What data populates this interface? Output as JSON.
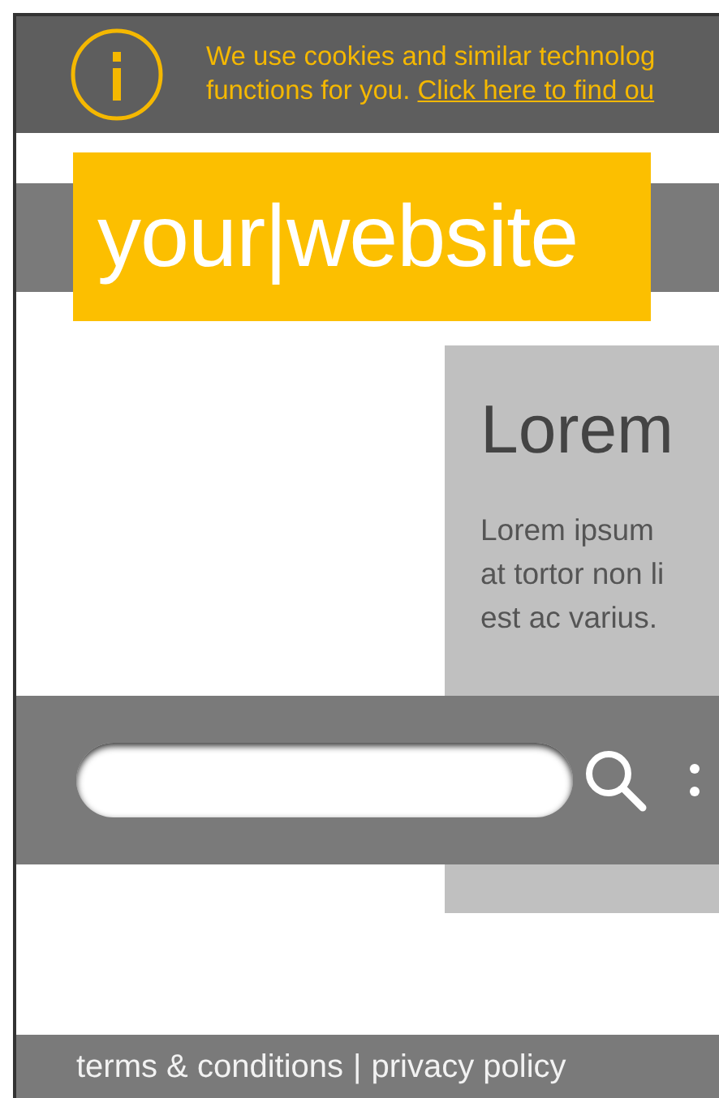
{
  "cookie_notice": {
    "line_1": "We use cookies and similar technolog",
    "line_2_text": "functions for you.",
    "line_2_link": "Click here to find ou"
  },
  "logo": {
    "text": "your|website"
  },
  "content_card": {
    "heading": "Lorem",
    "paragraph_lines": [
      "Lorem ipsum",
      "at tortor non li",
      "est ac varius."
    ]
  },
  "search": {
    "bullet_points": [
      {
        "kind": "dot"
      },
      {
        "kind": "dot"
      }
    ]
  },
  "footer": {
    "links": [
      "terms & conditions",
      "privacy policy"
    ],
    "separator": "|"
  }
}
